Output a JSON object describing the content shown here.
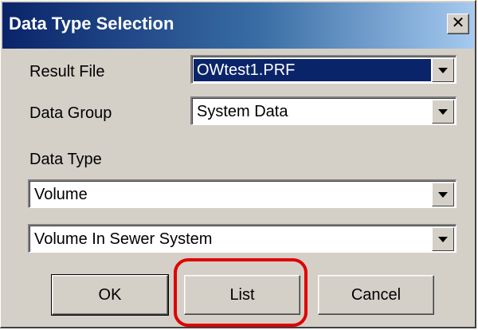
{
  "window": {
    "title": "Data Type Selection",
    "close_glyph": "✕"
  },
  "form": {
    "result_file": {
      "label": "Result File",
      "value": "OWtest1.PRF"
    },
    "data_group": {
      "label": "Data Group",
      "value": "System Data"
    },
    "data_type": {
      "label": "Data Type",
      "value": "Volume",
      "subtype_value": "Volume In Sewer System"
    }
  },
  "buttons": {
    "ok": "OK",
    "list": "List",
    "cancel": "Cancel"
  },
  "colors": {
    "title_gradient_start": "#0a246a",
    "highlight_red": "#e00000",
    "dialog_face": "#d4d0c8"
  }
}
